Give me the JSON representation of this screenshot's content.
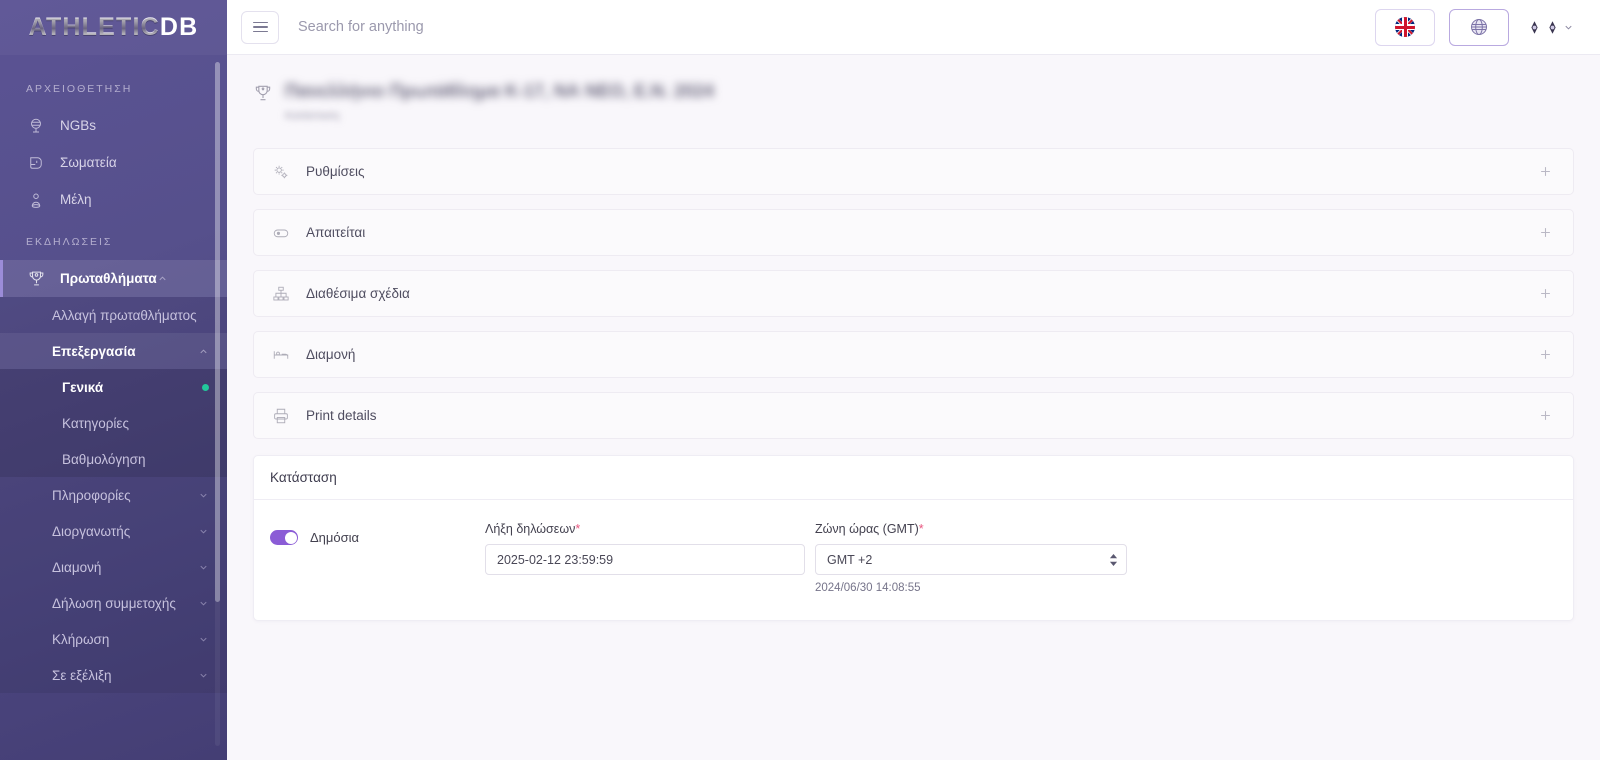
{
  "brand": {
    "name_part1": "ATHLETIC",
    "name_part2": "DB"
  },
  "topbar": {
    "menu_icon": "hamburger-icon",
    "search_placeholder": "Search for anything",
    "search_value": "",
    "language_icon": "uk-flag-icon",
    "globe_icon": "globe-icon",
    "user_chevron": "chevron-down-icon"
  },
  "sidebar": {
    "sections": [
      {
        "label": "ΑΡΧΕΙΟΘΕΤΗΣΗ",
        "items": [
          {
            "label": "NGBs",
            "icon": "globe-stand-icon"
          },
          {
            "label": "Σωματεία",
            "icon": "boxing-glove-icon"
          },
          {
            "label": "Μέλη",
            "icon": "member-pin-icon"
          }
        ]
      },
      {
        "label": "ΕΚΔΗΛΩΣΕΙΣ",
        "items": [
          {
            "label": "Πρωταθλήματα",
            "icon": "trophy-icon",
            "expanded": true
          }
        ]
      }
    ],
    "sub_items": [
      {
        "label": "Αλλαγή πρωταθλήματος",
        "expandable": false
      },
      {
        "label": "Επεξεργασία",
        "expandable": true,
        "expanded": true,
        "bold": true
      }
    ],
    "edit_children": [
      {
        "label": "Γενικά",
        "current": true,
        "dot": true
      },
      {
        "label": "Κατηγορίες",
        "current": false,
        "dot": false
      },
      {
        "label": "Βαθμολόγηση",
        "current": false,
        "dot": false
      }
    ],
    "collapsed_items": [
      {
        "label": "Πληροφορίες"
      },
      {
        "label": "Διοργανωτής"
      },
      {
        "label": "Διαμονή"
      },
      {
        "label": "Δήλωση συμμετοχής"
      },
      {
        "label": "Κλήρωση"
      },
      {
        "label": "Σε εξέλιξη"
      }
    ]
  },
  "page": {
    "title_icon": "trophy-icon",
    "title": "Πανελλήνιο Πρωτάθλημα Κ-17, ΝΑ ΝΕΟ, Ε.Ν. 2024",
    "subtitle": "Κατάσταση"
  },
  "accordions": [
    {
      "label": "Ρυθμίσεις",
      "icon": "gears-icon",
      "expand_icon": "plus-icon"
    },
    {
      "label": "Απαιτείται",
      "icon": "toggle-icon",
      "expand_icon": "plus-icon"
    },
    {
      "label": "Διαθέσιμα σχέδια",
      "icon": "org-chart-icon",
      "expand_icon": "plus-icon"
    },
    {
      "label": "Διαμονή",
      "icon": "bed-icon",
      "expand_icon": "plus-icon"
    },
    {
      "label": "Print details",
      "icon": "printer-icon",
      "expand_icon": "plus-icon"
    }
  ],
  "status_card": {
    "title": "Κατάσταση",
    "public_toggle": {
      "label": "Δημόσια",
      "on": true
    },
    "deadline": {
      "label": "Λήξη δηλώσεων",
      "required_mark": "*",
      "value": "2025-02-12 23:59:59"
    },
    "timezone": {
      "label": "Ζώνη ώρας (GMT)",
      "required_mark": "*",
      "value": "GMT +2",
      "helper": "2024/06/30 14:08:55"
    }
  },
  "colors": {
    "sidebar_start": "#5b5394",
    "sidebar_end": "#443e74",
    "accent_purple": "#8b5cd6",
    "active_dot_green": "#22c79b",
    "required_pink": "#e8567f",
    "page_background": "#f9f7fb"
  }
}
